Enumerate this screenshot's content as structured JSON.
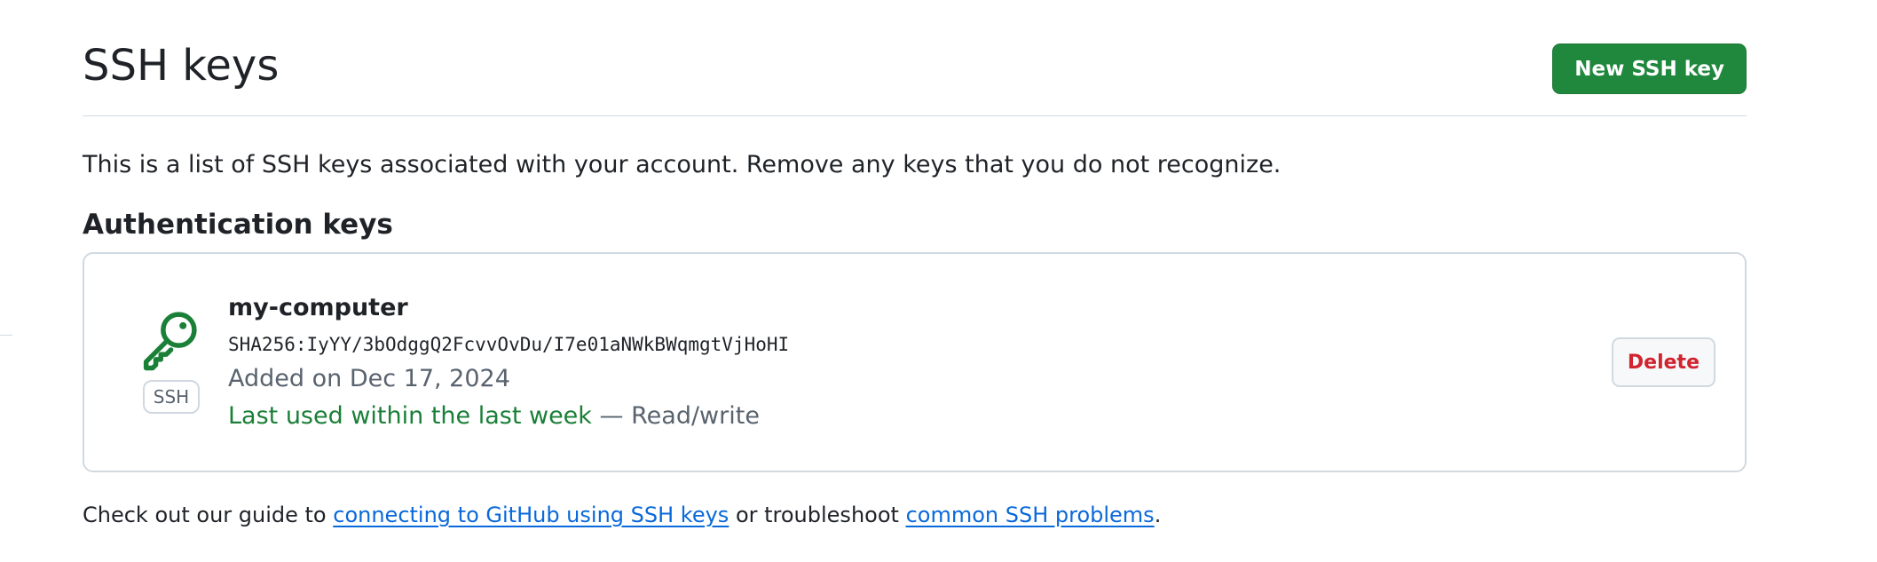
{
  "header": {
    "title": "SSH keys",
    "new_key_button": "New SSH key"
  },
  "intro": "This is a list of SSH keys associated with your account. Remove any keys that you do not recognize.",
  "section": {
    "title": "Authentication keys"
  },
  "keys": [
    {
      "icon": "key-icon",
      "type": "SSH",
      "name": "my-computer",
      "fingerprint": "SHA256:IyYY/3bOdggQ2FcvvOvDu/I7e01aNWkBWqmgtVjHoHI",
      "added": "Added on Dec 17, 2024",
      "last_used": "Last used within the last week",
      "separator": " — ",
      "access": "Read/write",
      "delete_label": "Delete"
    }
  ],
  "footer": {
    "text_before": "Check out our guide to ",
    "link_guide": "connecting to GitHub using SSH keys",
    "text_middle": " or troubleshoot ",
    "link_problems": "common SSH problems",
    "text_after": "."
  },
  "colors": {
    "primary_button": "#1f883d",
    "danger": "#d1242f",
    "success": "#1a7f37",
    "link": "#0969da",
    "muted": "#59636e",
    "border": "#d1d9e0"
  }
}
